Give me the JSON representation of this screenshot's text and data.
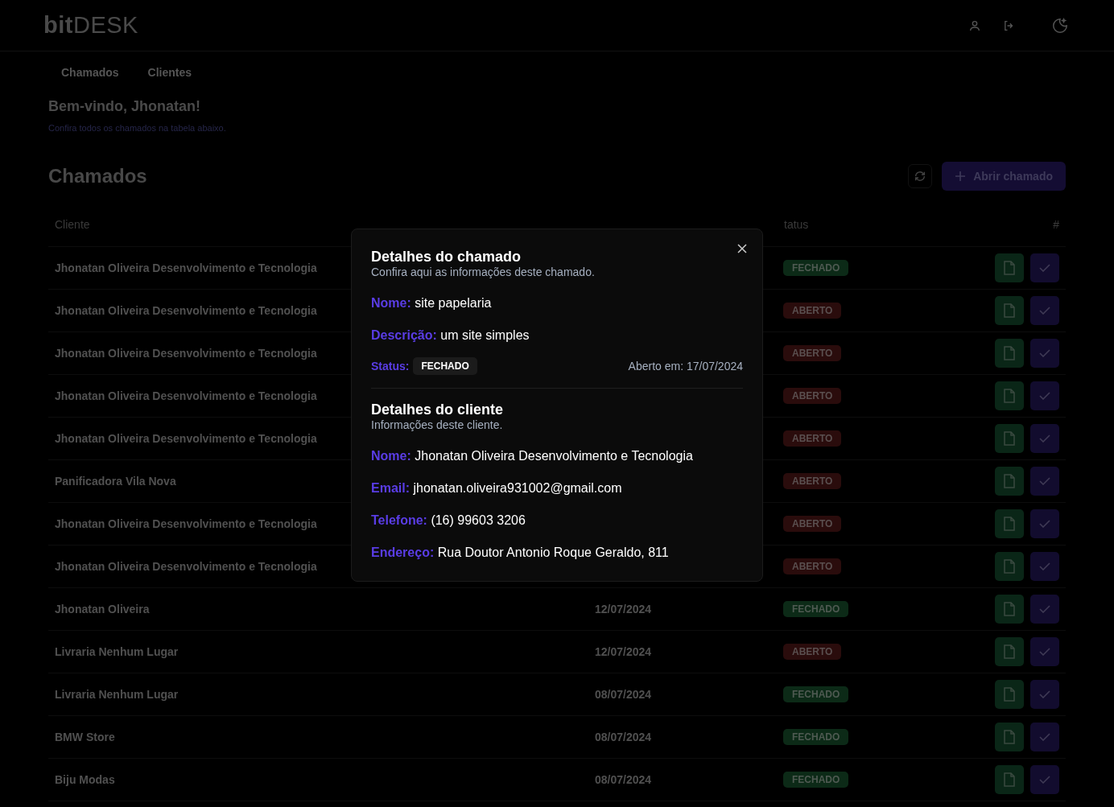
{
  "header": {
    "logo": "**bit**DESK"
  },
  "nav": [
    {
      "label": "Chamados"
    },
    {
      "label": "Clientes"
    }
  ],
  "welcome": {
    "title": "Bem-vindo, Jhonatan!",
    "subtitle": "Confira todos os chamados na tabela abaixo."
  },
  "section": {
    "title": "Chamados",
    "new_button": "Abrir chamado"
  },
  "table": {
    "columns": [
      {
        "kind": "client",
        "label": "Cliente"
      },
      {
        "kind": "date"
      },
      {
        "kind": "status",
        "label": "tatus"
      },
      {
        "kind": "actions",
        "label": "#"
      }
    ],
    "rows": [
      {
        "client": "Jhonatan Oliveira Desenvolvimento e Tecnologia",
        "status": {
          "text": "FECHADO",
          "kind": "closed"
        }
      },
      {
        "client": "Jhonatan Oliveira Desenvolvimento e Tecnologia",
        "status": {
          "text": "ABERTO",
          "kind": "open"
        }
      },
      {
        "client": "Jhonatan Oliveira Desenvolvimento e Tecnologia",
        "status": {
          "text": "ABERTO",
          "kind": "open"
        }
      },
      {
        "client": "Jhonatan Oliveira Desenvolvimento e Tecnologia",
        "status": {
          "text": "ABERTO",
          "kind": "open"
        }
      },
      {
        "client": "Jhonatan Oliveira Desenvolvimento e Tecnologia",
        "status": {
          "text": "ABERTO",
          "kind": "open"
        }
      },
      {
        "client": "Panificadora Vila Nova",
        "status": {
          "text": "ABERTO",
          "kind": "open"
        }
      },
      {
        "client": "Jhonatan Oliveira Desenvolvimento e Tecnologia",
        "status": {
          "text": "ABERTO",
          "kind": "open"
        }
      },
      {
        "client": "Jhonatan Oliveira Desenvolvimento e Tecnologia",
        "status": {
          "text": "ABERTO",
          "kind": "open"
        }
      },
      {
        "client": "Jhonatan Oliveira",
        "date": "12/07/2024",
        "status": {
          "text": "FECHADO",
          "kind": "closed"
        }
      },
      {
        "client": "Livraria Nenhum Lugar",
        "date": "12/07/2024",
        "status": {
          "text": "ABERTO",
          "kind": "open"
        }
      },
      {
        "client": "Livraria Nenhum Lugar",
        "date": "08/07/2024",
        "status": {
          "text": "FECHADO",
          "kind": "closed"
        }
      },
      {
        "client": "BMW Store",
        "date": "08/07/2024",
        "status": {
          "text": "FECHADO",
          "kind": "closed"
        }
      },
      {
        "client": "Biju Modas",
        "date": "08/07/2024",
        "status": {
          "text": "FECHADO",
          "kind": "closed"
        }
      }
    ]
  },
  "modal": {
    "title": "Detalhes do chamado",
    "subtitle": "Confira aqui as informações deste chamado.",
    "fields": [
      {
        "label": "Nome:",
        "value": "site papelaria"
      },
      {
        "label": "Descrição:",
        "value": "um site simples"
      }
    ],
    "status": {
      "label": "Status:",
      "badge": "FECHADO"
    },
    "opened": "Aberto em: 17/07/2024",
    "client_title": "Detalhes do cliente",
    "client_subtitle": "Informações deste cliente.",
    "client_fields": [
      {
        "label": "Nome:",
        "value": "Jhonatan Oliveira Desenvolvimento e Tecnologia"
      },
      {
        "label": "Email:",
        "value": "jhonatan.oliveira931002@gmail.com"
      },
      {
        "label": "Telefone:",
        "value": "(16) 99603 3206"
      },
      {
        "label": "Endereço:",
        "value": "Rua Doutor Antonio Roque Geraldo, 811"
      }
    ]
  }
}
